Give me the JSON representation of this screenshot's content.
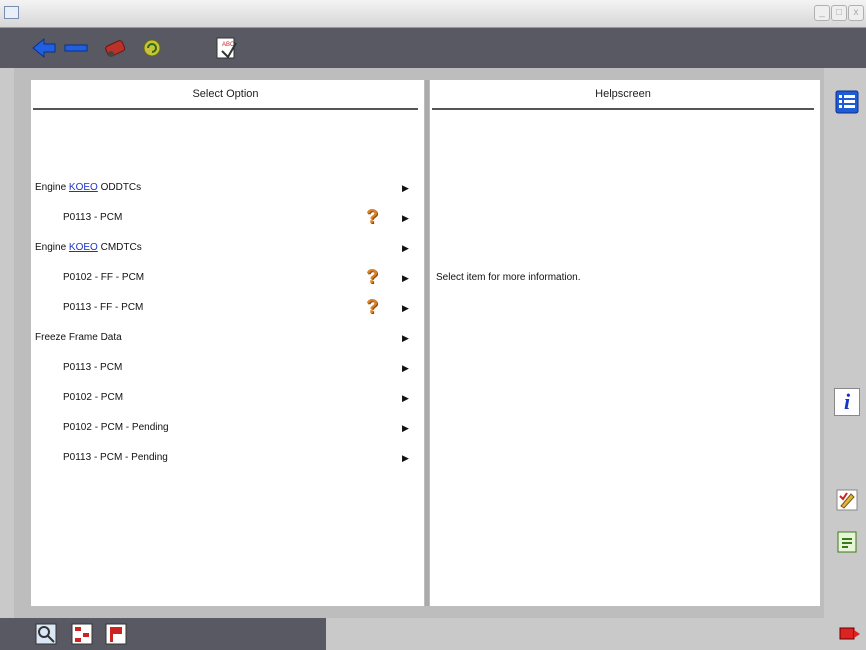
{
  "window": {
    "title": "",
    "minimize": "_",
    "maximize": "□",
    "close": "x"
  },
  "toolbar": {
    "buttons": [
      "back-icon",
      "minus-icon",
      "vehicle-icon",
      "refresh-icon",
      "report-icon"
    ]
  },
  "left_panel": {
    "header": "Select Option",
    "rows": [
      {
        "indent": 0,
        "prefix": "Engine ",
        "link": "KOEO",
        "suffix": " ODDTCs",
        "help": false
      },
      {
        "indent": 1,
        "prefix": "P0113 - PCM",
        "link": "",
        "suffix": "",
        "help": true
      },
      {
        "indent": 0,
        "prefix": "Engine ",
        "link": "KOEO",
        "suffix": " CMDTCs",
        "help": false
      },
      {
        "indent": 1,
        "prefix": "P0102 - FF - PCM",
        "link": "",
        "suffix": "",
        "help": true
      },
      {
        "indent": 1,
        "prefix": "P0113 - FF - PCM",
        "link": "",
        "suffix": "",
        "help": true
      },
      {
        "indent": 0,
        "prefix": "Freeze Frame Data",
        "link": "",
        "suffix": "",
        "help": false
      },
      {
        "indent": 1,
        "prefix": "P0113 - PCM",
        "link": "",
        "suffix": "",
        "help": false
      },
      {
        "indent": 1,
        "prefix": "P0102 - PCM",
        "link": "",
        "suffix": "",
        "help": false
      },
      {
        "indent": 1,
        "prefix": "P0102 - PCM - Pending",
        "link": "",
        "suffix": "",
        "help": false
      },
      {
        "indent": 1,
        "prefix": "P0113 - PCM - Pending",
        "link": "",
        "suffix": "",
        "help": false
      }
    ],
    "arrow": "▶",
    "help_glyph": "?"
  },
  "right_panel": {
    "header": "Helpscreen",
    "message": "Select item for more information."
  },
  "sidebar": {
    "buttons": [
      "list-icon",
      "info-icon",
      "edit-icon",
      "document-icon"
    ],
    "info_glyph": "i"
  },
  "colors": {
    "toolbar": "#595963",
    "link": "#1a33cc",
    "help": "#d9822b"
  }
}
